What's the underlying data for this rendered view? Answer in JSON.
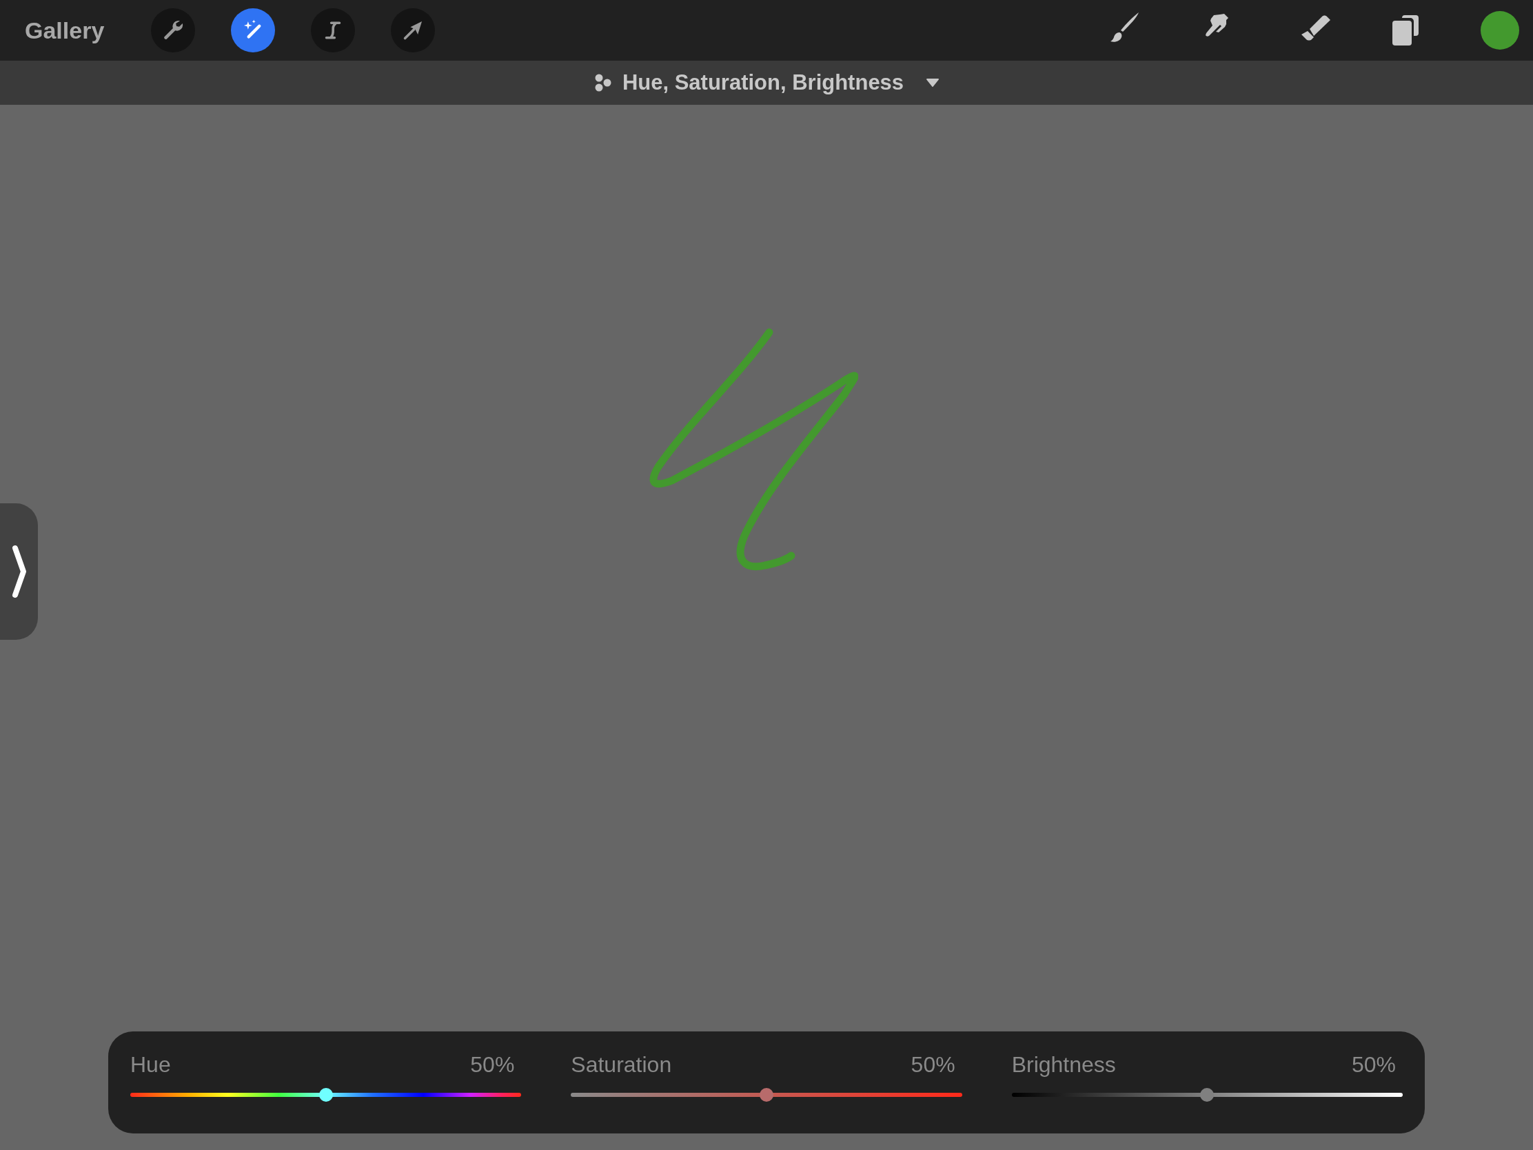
{
  "toolbar": {
    "gallery": "Gallery",
    "left_tools": [
      {
        "kind": "wrench",
        "selected": false
      },
      {
        "kind": "wand",
        "selected": true
      },
      {
        "kind": "selection",
        "selected": false
      },
      {
        "kind": "transform",
        "selected": false
      }
    ],
    "right_tools": [
      {
        "kind": "brush"
      },
      {
        "kind": "smudge"
      },
      {
        "kind": "eraser"
      },
      {
        "kind": "layers"
      }
    ],
    "color_swatch": {
      "color": "#43992e"
    }
  },
  "adjustment_bar": {
    "title": "Hue, Saturation, Brightness"
  },
  "sliders": [
    {
      "kind": "hue",
      "label": "Hue",
      "reading": "50%",
      "level": 0.5
    },
    {
      "kind": "saturation",
      "label": "Saturation",
      "reading": "50%",
      "level": 0.5
    },
    {
      "kind": "brightness",
      "label": "Brightness",
      "reading": "50%",
      "level": 0.5
    }
  ]
}
